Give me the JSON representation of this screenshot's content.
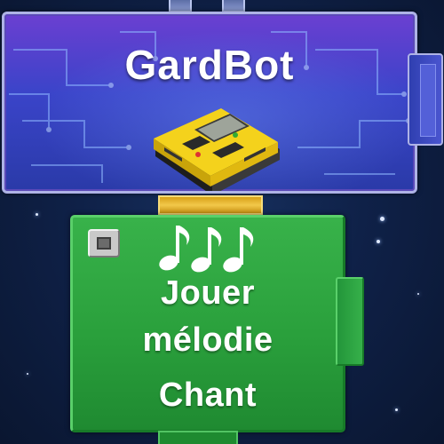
{
  "header": {
    "title": "GardBot",
    "icon": "programmable-brick-icon"
  },
  "block": {
    "icon": "music-notes-icon",
    "menu_icon": "block-menu-icon",
    "line1": "Jouer",
    "line2": "mélodie",
    "line3": "Chant"
  },
  "colors": {
    "background": "#0c1a3a",
    "header_panel": "#3a44c9",
    "connector": "#f2c84a",
    "block_green": "#2aa03c",
    "text": "#ffffff"
  }
}
